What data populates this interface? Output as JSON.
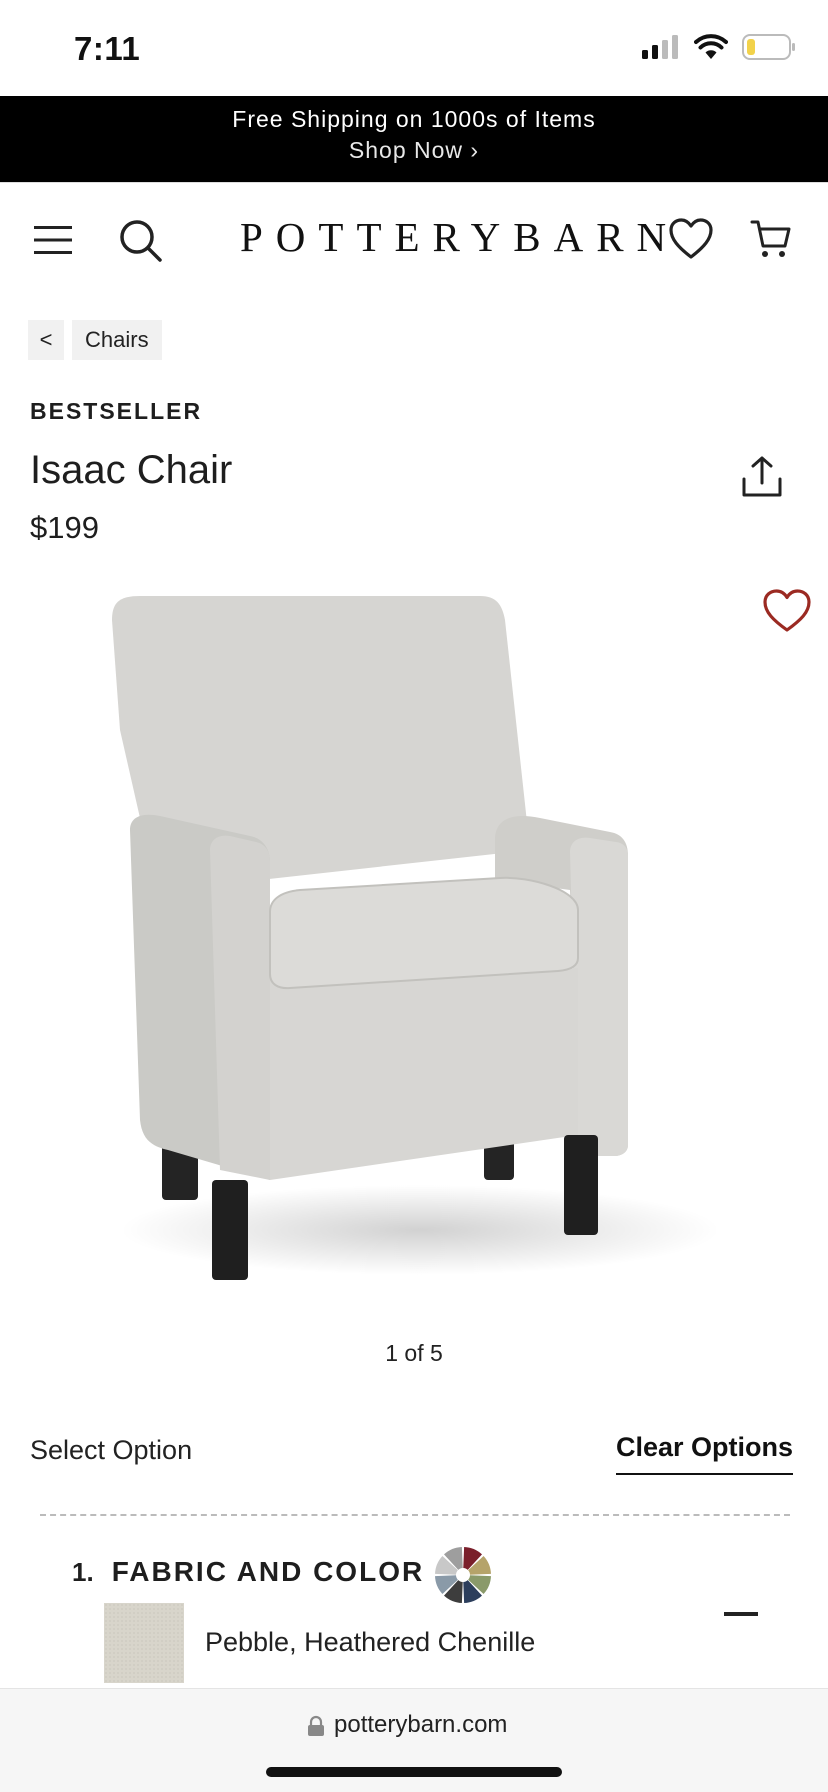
{
  "status_bar": {
    "time": "7:11",
    "icons": [
      "signal-icon",
      "wifi-icon",
      "battery-icon"
    ]
  },
  "promo": {
    "line1": "Free Shipping on 1000s of Items",
    "line2": "Shop Now ›"
  },
  "header": {
    "logo": "POTTERYBARN",
    "icons": [
      "menu-icon",
      "search-icon",
      "heart-icon",
      "cart-icon"
    ]
  },
  "breadcrumb": {
    "back": "<",
    "label": "Chairs"
  },
  "product": {
    "badge": "BESTSELLER",
    "title": "Isaac Chair",
    "price": "$199",
    "image_counter": "1 of 5"
  },
  "options": {
    "select_label": "Select Option",
    "clear_label": "Clear Options",
    "section_number": "1.",
    "section_title": "FABRIC AND COLOR",
    "selected_fabric": "Pebble, Heathered Chenille"
  },
  "browser": {
    "url": "potterybarn.com"
  },
  "colors": {
    "banner_bg": "#000000",
    "wishlist_heart": "#9b2a22",
    "swatch": "#d8d5cb",
    "chair_fabric": "#d4d3d0",
    "chair_legs": "#222222"
  },
  "color_wheel": [
    "#7a1f2b",
    "#b5a36a",
    "#8a9a6a",
    "#2c3e5c",
    "#3d3d3d",
    "#8a9aa8",
    "#c8c8c8",
    "#9e9e9e"
  ]
}
